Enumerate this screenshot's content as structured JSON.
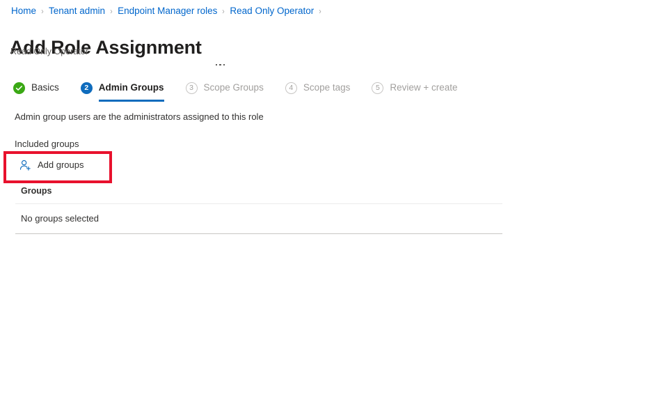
{
  "breadcrumb": {
    "separator": "›",
    "items": [
      {
        "label": "Home"
      },
      {
        "label": "Tenant admin"
      },
      {
        "label": "Endpoint Manager roles"
      },
      {
        "label": "Read Only Operator"
      }
    ]
  },
  "header": {
    "title": "Add Role Assignment",
    "subtitle": "Read Only Operator",
    "more_menu": "..."
  },
  "wizard": {
    "steps": [
      {
        "marker": "✓",
        "label": "Basics",
        "state": "done"
      },
      {
        "marker": "2",
        "label": "Admin Groups",
        "state": "current"
      },
      {
        "marker": "3",
        "label": "Scope Groups",
        "state": "pending"
      },
      {
        "marker": "4",
        "label": "Scope tags",
        "state": "pending"
      },
      {
        "marker": "5",
        "label": "Review + create",
        "state": "pending"
      }
    ]
  },
  "main": {
    "description": "Admin group users are the administrators assigned to this role",
    "included_groups_label": "Included groups",
    "add_groups_button": "Add groups",
    "add_groups_icon": "add-user-icon",
    "table": {
      "columns": [
        "Groups"
      ],
      "rows": [
        [
          "No groups selected"
        ]
      ]
    }
  },
  "colors": {
    "link": "#0066cc",
    "accent": "#0f6cbd",
    "success": "#3aa814",
    "highlight": "#e8112d",
    "muted_text": "#a19f9d"
  }
}
